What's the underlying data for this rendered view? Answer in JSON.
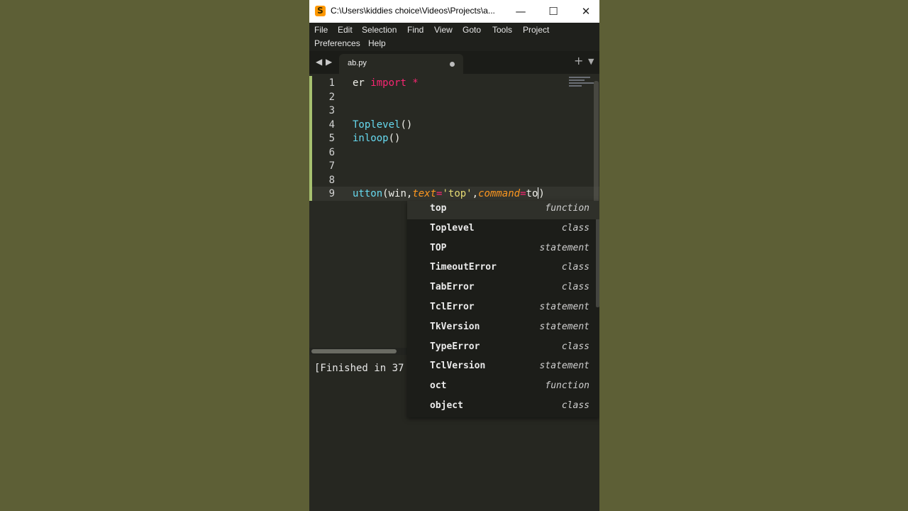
{
  "window": {
    "title": "C:\\Users\\kiddies choice\\Videos\\Projects\\a...",
    "app_icon": "sublime-text-icon",
    "controls": {
      "minimize": "—",
      "maximize": "☐",
      "close": "✕"
    }
  },
  "menu": {
    "items": [
      "File",
      "Edit",
      "Selection",
      "Find",
      "View",
      "Goto",
      "Tools",
      "Project",
      "Preferences",
      "Help"
    ]
  },
  "tabs": {
    "nav_left": "◀",
    "nav_right": "▶",
    "active": {
      "label": "ab.py",
      "modified": true
    },
    "new_tab": "+",
    "dropdown": "▼"
  },
  "editor": {
    "line_numbers": [
      "1",
      "2",
      "3",
      "4",
      "5",
      "6",
      "7",
      "8",
      "9"
    ],
    "active_line": 9,
    "lines": [
      [
        {
          "t": "er ",
          "c": ""
        },
        {
          "t": "import",
          "c": "kw"
        },
        {
          "t": " *",
          "c": "op"
        }
      ],
      [],
      [],
      [
        {
          "t": "Toplevel",
          "c": "fn"
        },
        {
          "t": "()",
          "c": ""
        }
      ],
      [
        {
          "t": "inloop",
          "c": "fn"
        },
        {
          "t": "()",
          "c": ""
        }
      ],
      [],
      [],
      [],
      [
        {
          "t": "utton",
          "c": "fn"
        },
        {
          "t": "(win,",
          "c": ""
        },
        {
          "t": "text",
          "c": "arg"
        },
        {
          "t": "=",
          "c": "op"
        },
        {
          "t": "'top'",
          "c": "str"
        },
        {
          "t": ",",
          "c": ""
        },
        {
          "t": "command",
          "c": "arg"
        },
        {
          "t": "=",
          "c": "op"
        },
        {
          "t": "to",
          "c": ""
        },
        {
          "t": "CARET",
          "c": "caret"
        },
        {
          "t": ")",
          "c": ""
        }
      ]
    ]
  },
  "output": {
    "text": "[Finished in 37"
  },
  "autocomplete": {
    "selected_index": 0,
    "items": [
      {
        "name": "top",
        "kind": "function"
      },
      {
        "name": "Toplevel",
        "kind": "class"
      },
      {
        "name": "TOP",
        "kind": "statement"
      },
      {
        "name": "TimeoutError",
        "kind": "class"
      },
      {
        "name": "TabError",
        "kind": "class"
      },
      {
        "name": "TclError",
        "kind": "statement"
      },
      {
        "name": "TkVersion",
        "kind": "statement"
      },
      {
        "name": "TypeError",
        "kind": "class"
      },
      {
        "name": "TclVersion",
        "kind": "statement"
      },
      {
        "name": "oct",
        "kind": "function"
      },
      {
        "name": "object",
        "kind": "class"
      }
    ]
  },
  "colors": {
    "background": "#5d5f36",
    "editor_bg": "#282923",
    "keyword": "#f92672",
    "function": "#66d9ef",
    "string": "#e6db74",
    "argument": "#fd971f"
  }
}
